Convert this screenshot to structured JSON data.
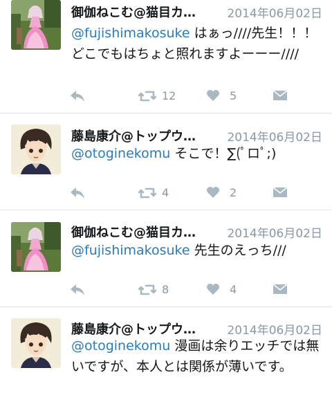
{
  "tweets": [
    {
      "name": "御伽ねこむ@猫目カ…",
      "date": "2014年06月02日",
      "mention": "@fujishimakosuke",
      "text": " はぁっ////先生！！！どこでもはちょと照れますよーーー////",
      "retweets": "12",
      "likes": "5",
      "avatar": "girl-in-pink-dress"
    },
    {
      "name": "藤島康介@トップウ…",
      "date": "2014年06月02日",
      "mention": "@otoginekomu",
      "text": " そこで！∑(ﾟロﾟ;)",
      "retweets": "4",
      "likes": "2",
      "avatar": "anime-boy"
    },
    {
      "name": "御伽ねこむ@猫目カ…",
      "date": "2014年06月02日",
      "mention": "@fujishimakosuke",
      "text": " 先生のえっち///",
      "retweets": "8",
      "likes": "4",
      "avatar": "girl-in-pink-dress"
    },
    {
      "name": "藤島康介@トップウ…",
      "date": "2014年06月02日",
      "mention": "@otoginekomu",
      "text": " 漫画は余りエッチでは無いですが、本人とは関係が薄いです。",
      "avatar": "anime-boy"
    }
  ],
  "colors": {
    "mention": "#2b7bb9",
    "meta": "#8899a6",
    "divider": "#e1e8ed"
  },
  "icons": [
    "reply-icon",
    "retweet-icon",
    "like-icon",
    "direct-message-icon"
  ]
}
